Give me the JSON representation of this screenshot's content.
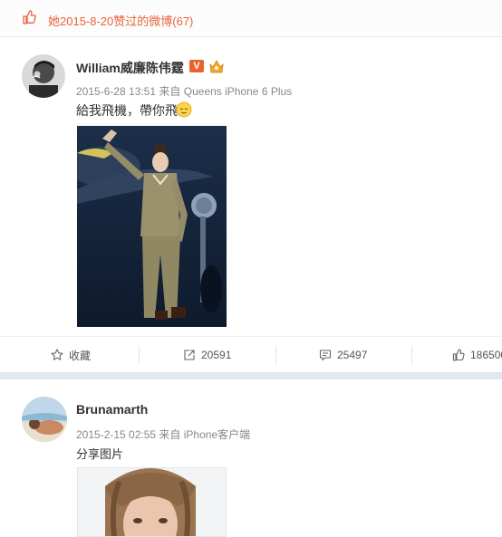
{
  "header": {
    "text": "她2015-8-20赞过的微博(67)",
    "icon": "thumbs-up-icon",
    "accent_color": "#e8643a"
  },
  "posts": [
    {
      "author": "William威廉陈伟霆",
      "verified_badge": "V",
      "timestamp": "2015-6-28 13:51",
      "source": "来自 Queens iPhone 6 Plus",
      "text": "給我飛機，帶你飛",
      "emoji": "relieved-face-emoji",
      "actions": {
        "favorite_label": "收藏",
        "repost_count": "20591",
        "comment_count": "25497",
        "like_count": "186500"
      }
    },
    {
      "author": "Brunamarth",
      "timestamp": "2015-2-15 02:55",
      "source": "来自 iPhone客户端",
      "text": "分享图片"
    }
  ]
}
